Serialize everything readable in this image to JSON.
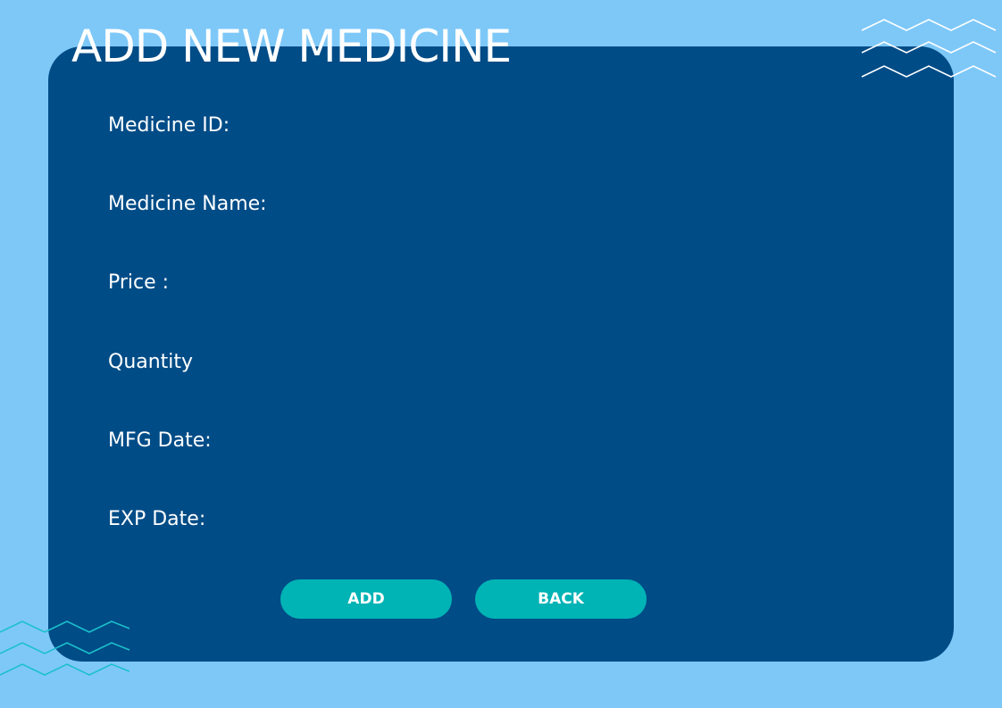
{
  "title": "ADD NEW MEDICINE",
  "fields": [
    {
      "label": "Medicine ID:"
    },
    {
      "label": "Medicine Name:"
    },
    {
      "label": "Price :"
    },
    {
      "label": "Quantity"
    },
    {
      "label": "MFG Date:"
    },
    {
      "label": "EXP Date:"
    }
  ],
  "buttons": {
    "add_label": "ADD",
    "back_label": "BACK"
  },
  "colors": {
    "background": "#7ec8f8",
    "panel": "#004c87",
    "button": "#00b3b5",
    "text": "#ffffff",
    "zigzag_top": "#ffffff",
    "zigzag_bottom": "#1cc0cc"
  },
  "icons": [
    "zigzag-decoration-top-right",
    "zigzag-decoration-bottom-left"
  ]
}
